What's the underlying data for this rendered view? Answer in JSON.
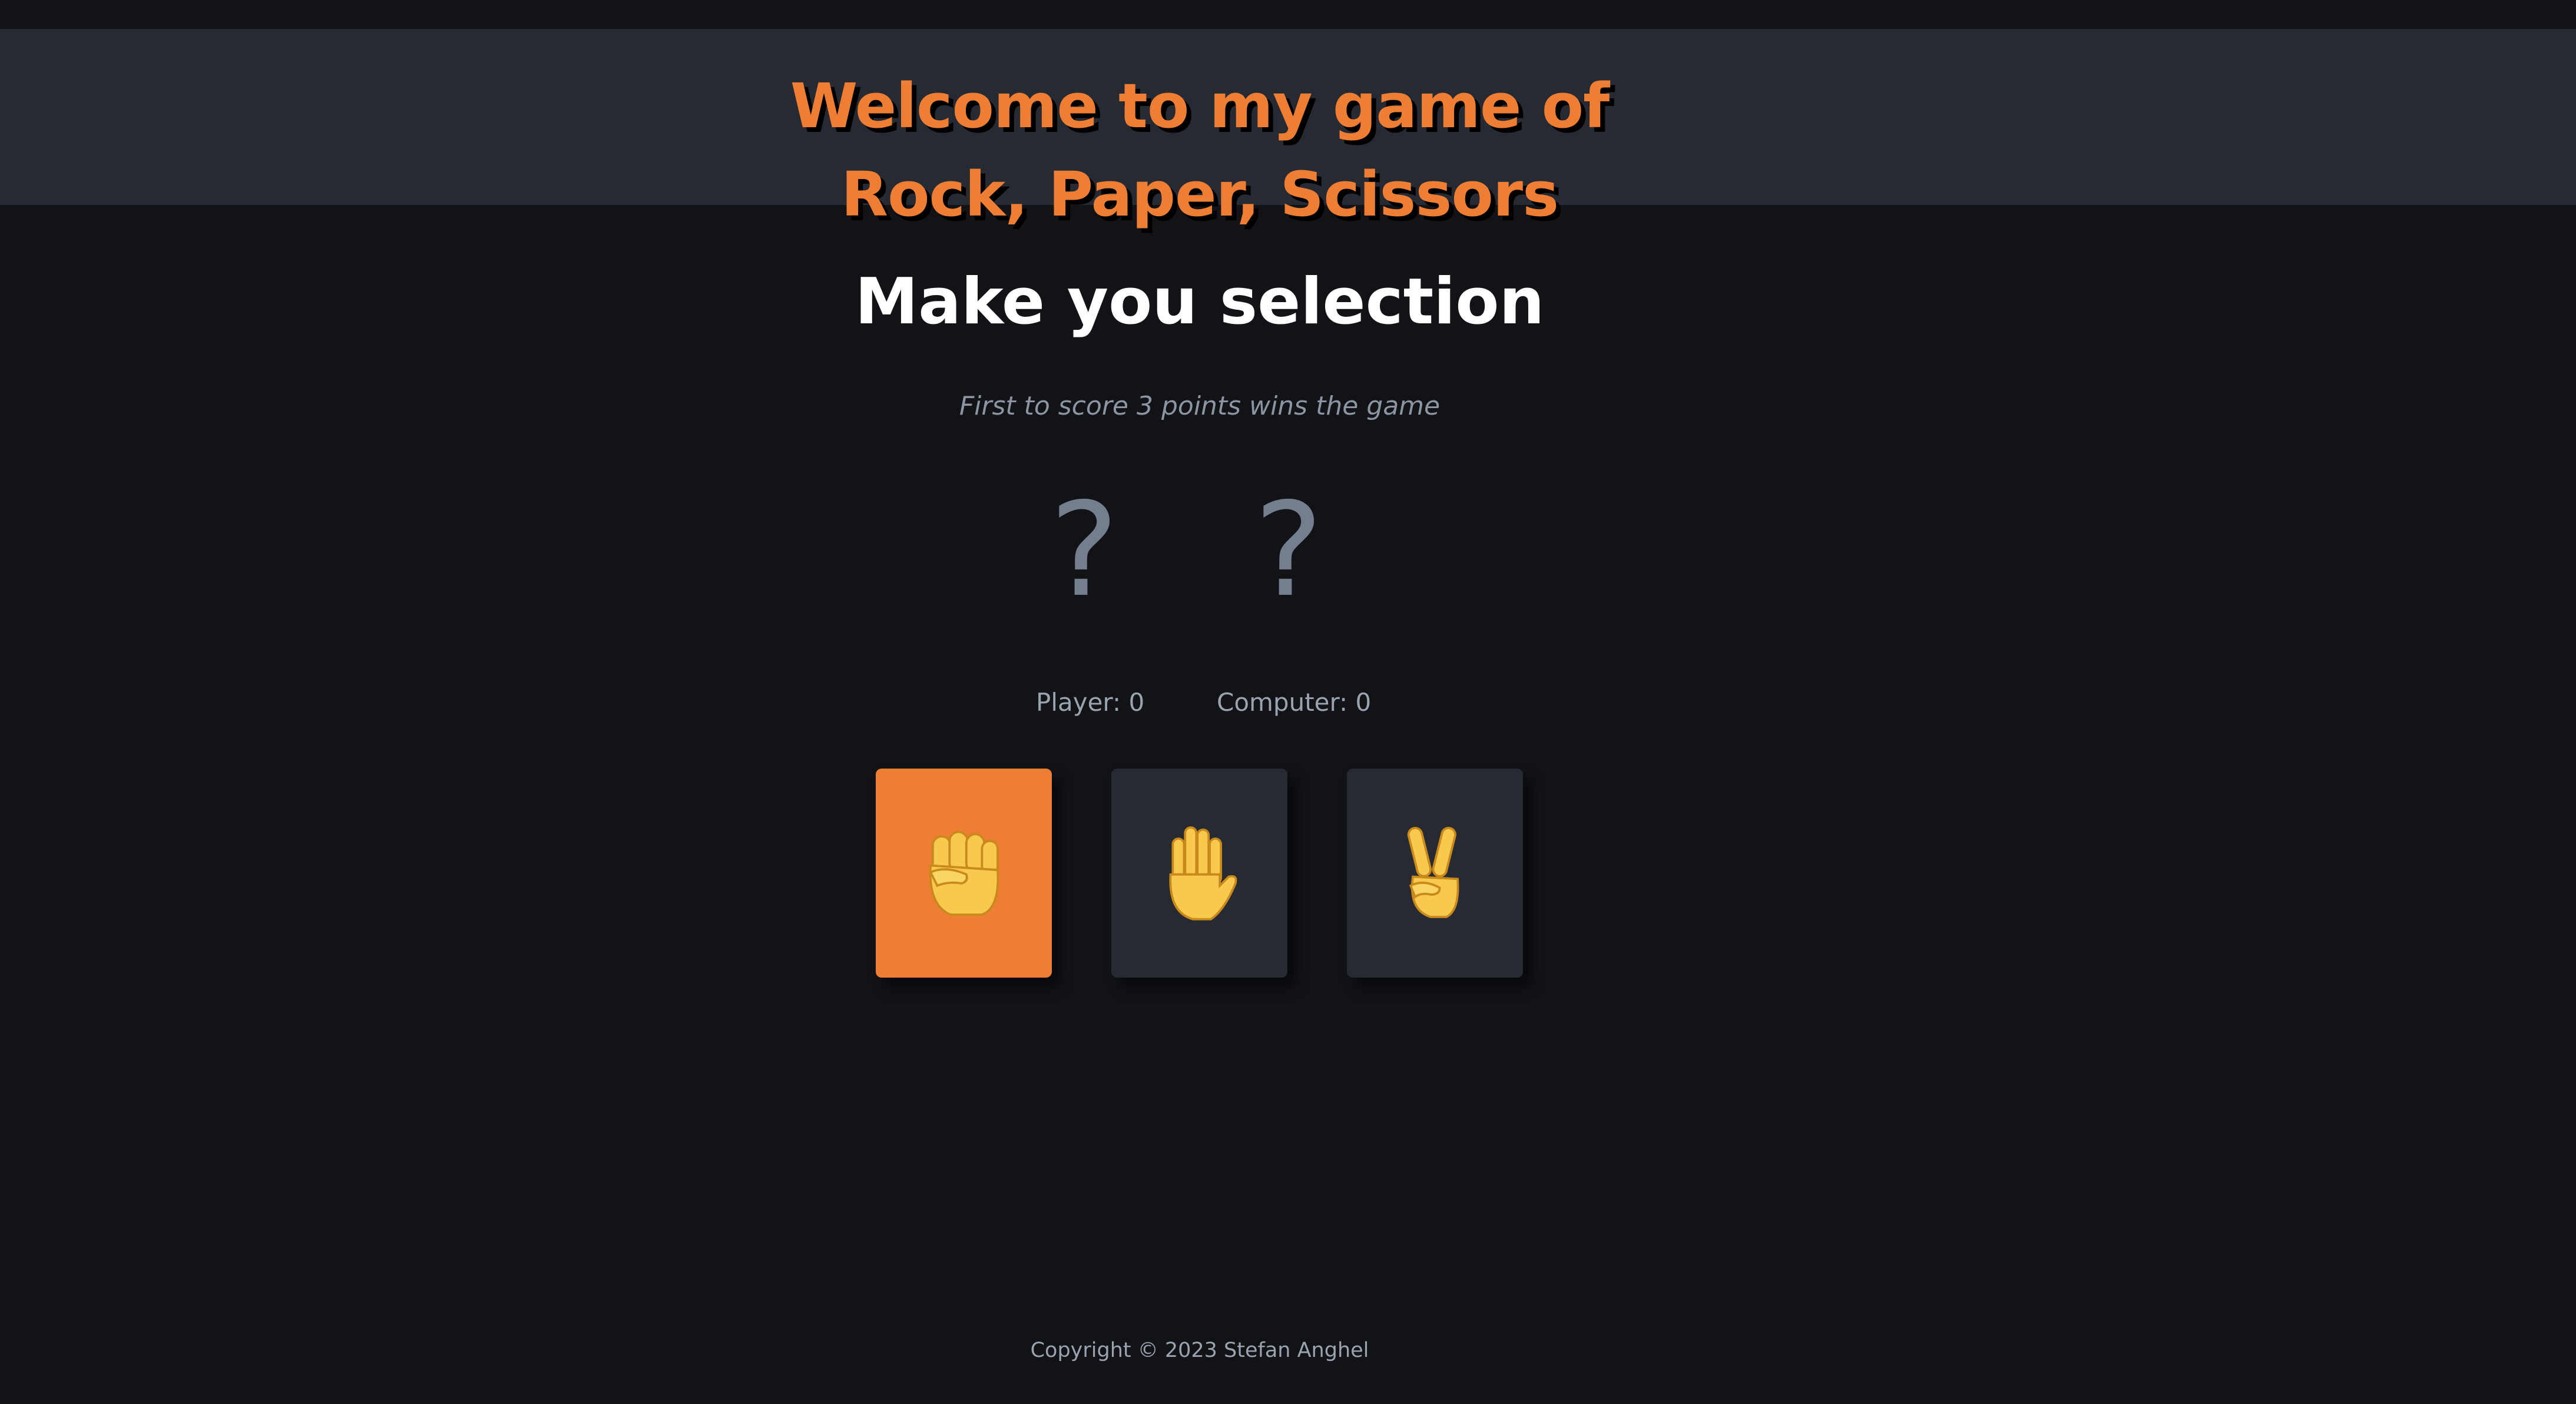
{
  "header": {
    "title_line1": "Welcome to my game of",
    "title_line2": "Rock, Paper, Scissors"
  },
  "main": {
    "heading": "Make you selection",
    "subtitle": "First to score 3 points wins the game",
    "player_choice": "?",
    "computer_choice": "?",
    "player_score_label": "Player: 0",
    "computer_score_label": "Computer: 0"
  },
  "choices": [
    {
      "name": "Rock",
      "icon": "raised-fist-icon",
      "selected": true
    },
    {
      "name": "Paper",
      "icon": "raised-hand-icon",
      "selected": false
    },
    {
      "name": "Scissors",
      "icon": "victory-hand-icon",
      "selected": false
    }
  ],
  "footer": {
    "copyright": "Copyright © 2023 Stefan Anghel"
  },
  "colors": {
    "accent": "#ee7e34",
    "background": "#111317",
    "panel": "#252a33",
    "heading": "#ffffff",
    "muted": "#8b95a3",
    "question_mark": "#747e8e",
    "emoji": "#f7c94e"
  }
}
